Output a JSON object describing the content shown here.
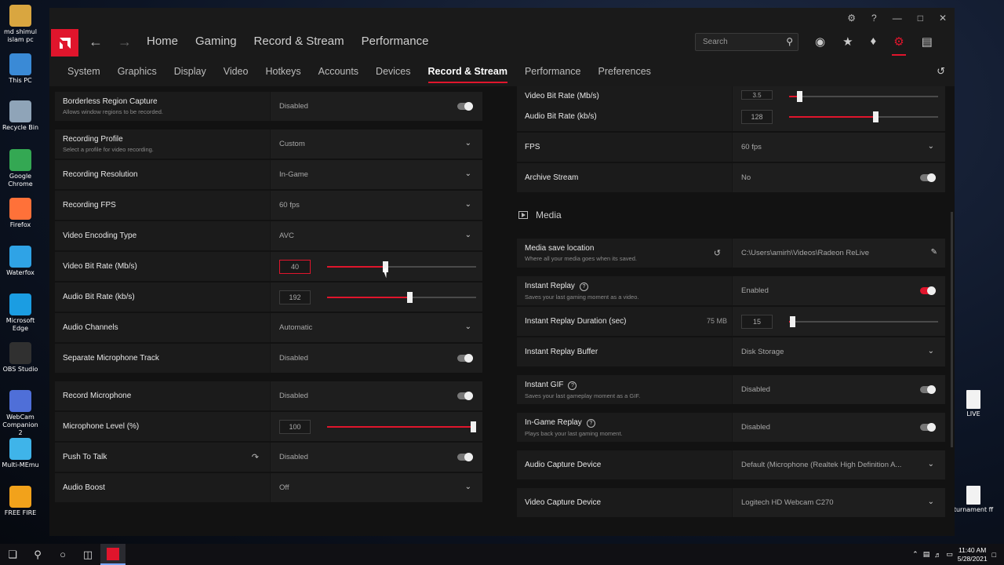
{
  "desktop": {
    "icons_left": [
      {
        "label": "md shimul islam pc",
        "color": "#d9a640"
      },
      {
        "label": "This PC",
        "color": "#3a8ad6"
      },
      {
        "label": "Recycle Bin",
        "color": "#8fa4b8"
      },
      {
        "label": "Google Chrome",
        "color": "#34a853"
      },
      {
        "label": "Firefox",
        "color": "#ff7139"
      },
      {
        "label": "Waterfox",
        "color": "#2fa3e6"
      },
      {
        "label": "Microsoft Edge",
        "color": "#1b9de2"
      },
      {
        "label": "OBS Studio",
        "color": "#303030"
      },
      {
        "label": "WebCam Companion 2",
        "color": "#4f6fd8"
      },
      {
        "label": "Multi-MEmu",
        "color": "#3fb4e9"
      },
      {
        "label": "FREE FIRE",
        "color": "#f2a21b"
      }
    ],
    "icons_right": [
      {
        "label": "LIVE"
      },
      {
        "label": "turnament ff"
      }
    ]
  },
  "taskbar": {
    "time": "11:40 AM",
    "date": "5/28/2021"
  },
  "app": {
    "main_nav": [
      "Home",
      "Gaming",
      "Record & Stream",
      "Performance"
    ],
    "search_placeholder": "Search",
    "sub_nav": [
      "System",
      "Graphics",
      "Display",
      "Video",
      "Hotkeys",
      "Accounts",
      "Devices",
      "Record & Stream",
      "Performance",
      "Preferences"
    ],
    "sub_nav_active": "Record & Stream",
    "left": {
      "borderless": {
        "label": "Borderless Region Capture",
        "sub": "Allows window regions to be recorded.",
        "value": "Disabled"
      },
      "recording_profile": {
        "label": "Recording Profile",
        "sub": "Select a profile for video recording.",
        "value": "Custom"
      },
      "recording_resolution": {
        "label": "Recording Resolution",
        "value": "In-Game"
      },
      "recording_fps": {
        "label": "Recording FPS",
        "value": "60 fps"
      },
      "video_encoding": {
        "label": "Video Encoding Type",
        "value": "AVC"
      },
      "video_bitrate": {
        "label": "Video Bit Rate (Mb/s)",
        "value": "40",
        "fraction": 0.39
      },
      "audio_bitrate": {
        "label": "Audio Bit Rate (kb/s)",
        "value": "192",
        "fraction": 0.55
      },
      "audio_channels": {
        "label": "Audio Channels",
        "value": "Automatic"
      },
      "separate_mic": {
        "label": "Separate Microphone Track",
        "value": "Disabled"
      },
      "record_mic": {
        "label": "Record Microphone",
        "value": "Disabled"
      },
      "mic_level": {
        "label": "Microphone Level (%)",
        "value": "100",
        "fraction": 1.0
      },
      "push_to_talk": {
        "label": "Push To Talk",
        "value": "Disabled"
      },
      "audio_boost": {
        "label": "Audio Boost",
        "value": "Off"
      }
    },
    "right": {
      "video_bitrate_partial": {
        "label": "Video Bit Rate (Mb/s)",
        "value": "3.5",
        "fraction": 0.07
      },
      "audio_bitrate": {
        "label": "Audio Bit Rate (kb/s)",
        "value": "128",
        "fraction": 0.58
      },
      "fps": {
        "label": "FPS",
        "value": "60 fps"
      },
      "archive": {
        "label": "Archive Stream",
        "value": "No"
      },
      "media_heading": "Media",
      "media_save": {
        "label": "Media save location",
        "sub": "Where all your media goes when its saved.",
        "value": "C:\\Users\\amirh\\Videos\\Radeon ReLive"
      },
      "instant_replay": {
        "label": "Instant Replay",
        "sub": "Saves your last gaming moment as a video.",
        "value": "Enabled"
      },
      "replay_duration": {
        "label": "Instant Replay Duration (sec)",
        "size": "75 MB",
        "value": "15",
        "fraction": 0.02
      },
      "replay_buffer": {
        "label": "Instant Replay Buffer",
        "value": "Disk Storage"
      },
      "instant_gif": {
        "label": "Instant GIF",
        "sub": "Saves your last gameplay moment as a GIF.",
        "value": "Disabled"
      },
      "ingame_replay": {
        "label": "In-Game Replay",
        "sub": "Plays back your last gaming moment.",
        "value": "Disabled"
      },
      "audio_capture": {
        "label": "Audio Capture Device",
        "value": "Default (Microphone (Realtek High Definition A..."
      },
      "video_capture": {
        "label": "Video Capture Device",
        "value": "Logitech HD Webcam C270"
      }
    }
  },
  "colors": {
    "accent": "#e0152c",
    "panel": "#1b1b1b",
    "background": "#121212"
  }
}
